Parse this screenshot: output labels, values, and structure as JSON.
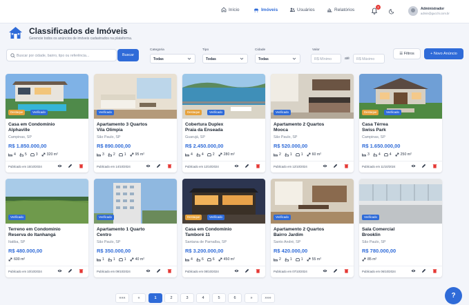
{
  "topbar": {
    "nav": [
      {
        "label": "Início",
        "icon": "home-icon",
        "active": false
      },
      {
        "label": "Imóveis",
        "icon": "car-icon",
        "active": true
      },
      {
        "label": "Usuários",
        "icon": "users-icon",
        "active": false
      },
      {
        "label": "Relatórios",
        "icon": "chart-icon",
        "active": false
      }
    ],
    "notifications": "2",
    "user_name": "Administrador",
    "user_email": "admin@gucchi.com.br"
  },
  "header": {
    "title": "Classificados de Imóveis",
    "subtitle": "Gerencie todos os anúncios de imóveis cadastrados na plataforma."
  },
  "filters": {
    "search_placeholder": "Buscar por cidade, bairro, tipo ou referência...",
    "search_button": "Buscar",
    "categoria_label": "Categoria",
    "categoria_value": "Todas",
    "tipo_label": "Tipo",
    "tipo_value": "Todas",
    "cidade_label": "Cidade",
    "cidade_value": "Todas",
    "valor_label": "Valor",
    "min_placeholder": "R$ Mínimo",
    "ate": "até",
    "max_placeholder": "R$ Máximo",
    "filter_button": "Filtros",
    "new_button": "+ Novo Anúncio"
  },
  "listings": [
    {
      "title1": "Casa em Condomínio",
      "title2": "Alphaville",
      "location": "Campinas, SP",
      "price": "R$ 1.850.000,00",
      "beds": "4",
      "baths": "5",
      "garage": "3",
      "area": "320 m²",
      "published": "Publicado em 15/10/2024",
      "destaque": true,
      "scene": "house-pool"
    },
    {
      "title1": "Apartamento 3 Quartos",
      "title2": "Vila Olímpia",
      "location": "São Paulo, SP",
      "price": "R$ 890.000,00",
      "beds": "3",
      "baths": "2",
      "garage": "1",
      "area": "95 m²",
      "published": "Publicado em 14/10/2024",
      "destaque": false,
      "scene": "living"
    },
    {
      "title1": "Cobertura Duplex",
      "title2": "Praia da Enseada",
      "location": "Guarujá, SP",
      "price": "R$ 2.450.000,00",
      "beds": "4",
      "baths": "4",
      "garage": "2",
      "area": "280 m²",
      "published": "Publicado em 12/10/2024",
      "destaque": true,
      "scene": "sea"
    },
    {
      "title1": "Apartamento 2 Quartos",
      "title2": "Mooca",
      "location": "São Paulo, SP",
      "price": "R$ 520.000,00",
      "beds": "2",
      "baths": "1",
      "garage": "1",
      "area": "60 m²",
      "published": "Publicado em 12/10/2024",
      "destaque": false,
      "scene": "kitchen"
    },
    {
      "title1": "Casa Térrea",
      "title2": "Swiss Park",
      "location": "Campinas, SP",
      "price": "R$ 1.650.000,00",
      "beds": "3",
      "baths": "4",
      "garage": "4",
      "area": "250 m²",
      "published": "Publicado em 11/10/2024",
      "destaque": true,
      "scene": "house"
    },
    {
      "title1": "Terreno em Condomínio",
      "title2": "Reserva do Itanhangá",
      "location": "Itatiba, SP",
      "price": "R$ 480.000,00",
      "area": "600 m²",
      "published": "Publicado em 10/10/2024",
      "destaque": false,
      "scene": "land"
    },
    {
      "title1": "Apartamento 1 Quarto",
      "title2": "Centro",
      "location": "São Paulo, SP",
      "price": "R$ 350.000,00",
      "beds": "1",
      "baths": "1",
      "garage": "1",
      "area": "40 m²",
      "published": "Publicado em 09/10/2024",
      "destaque": false,
      "scene": "tower"
    },
    {
      "title1": "Casa em Condomínio",
      "title2": "Tamboré 11",
      "location": "Santana de Parnaíba, SP",
      "price": "R$ 3.200.000,00",
      "beds": "4",
      "baths": "6",
      "garage": "6",
      "area": "450 m²",
      "published": "Publicado em 08/10/2024",
      "destaque": true,
      "scene": "night"
    },
    {
      "title1": "Apartamento 2 Quartos",
      "title2": "Bairro Jardim",
      "location": "Santo André, SP",
      "price": "R$ 420.000,00",
      "beds": "2",
      "baths": "1",
      "garage": "1",
      "area": "55 m²",
      "published": "Publicado em 07/10/2024",
      "destaque": false,
      "scene": "dining"
    },
    {
      "title1": "Sala Comercial",
      "title2": "Brooklin",
      "location": "São Paulo, SP",
      "price": "R$ 780.000,00",
      "area": "85 m²",
      "published": "Publicado em 06/10/2024",
      "destaque": false,
      "scene": "office"
    }
  ],
  "tags": {
    "destaque": "Destaque",
    "verificado": "Verificado"
  },
  "pagination": [
    "«««",
    "«",
    "1",
    "2",
    "3",
    "4",
    "5",
    "6",
    "»",
    "»»»"
  ],
  "pagination_current": "1",
  "help_label": "?",
  "colors": {
    "primary": "#2f6bd8",
    "destaque": "#e6a23c",
    "danger": "#e53935"
  }
}
